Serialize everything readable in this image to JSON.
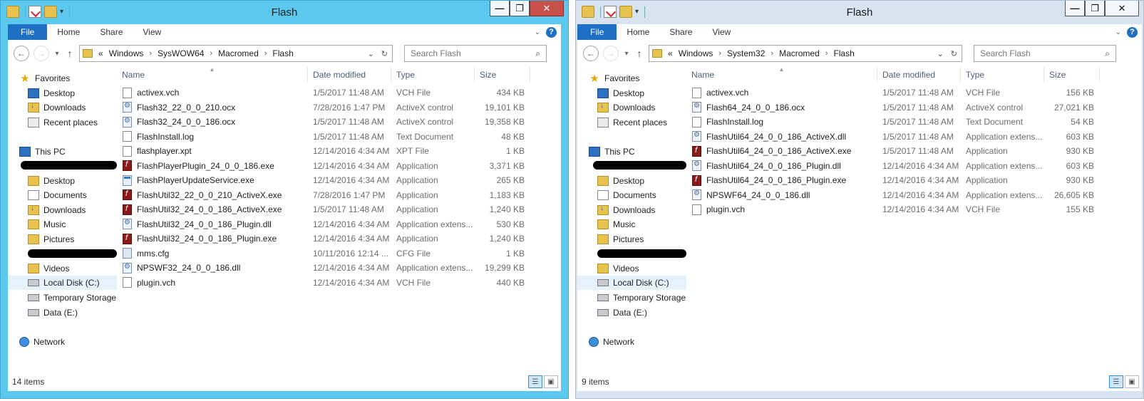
{
  "windows": [
    {
      "title": "Flash",
      "ribbon_tabs": [
        "File",
        "Home",
        "Share",
        "View"
      ],
      "address": [
        "«",
        "Windows",
        "SysWOW64",
        "Macromed",
        "Flash"
      ],
      "search_placeholder": "Search Flash",
      "nav": {
        "favorites": "Favorites",
        "desktop": "Desktop",
        "downloads": "Downloads",
        "recent": "Recent places",
        "thispc": "This PC",
        "pc_desktop": "Desktop",
        "documents": "Documents",
        "pc_downloads": "Downloads",
        "music": "Music",
        "pictures": "Pictures",
        "videos": "Videos",
        "localdisk": "Local Disk (C:)",
        "tempstorage": "Temporary Storage (",
        "data": "Data (E:)",
        "network": "Network"
      },
      "columns": [
        "Name",
        "Date modified",
        "Type",
        "Size"
      ],
      "files": [
        {
          "name": "activex.vch",
          "date": "1/5/2017 11:48 AM",
          "type": "VCH File",
          "size": "434 KB",
          "icon": "doc"
        },
        {
          "name": "Flash32_22_0_0_210.ocx",
          "date": "7/28/2016 1:47 PM",
          "type": "ActiveX control",
          "size": "19,101 KB",
          "icon": "gear"
        },
        {
          "name": "Flash32_24_0_0_186.ocx",
          "date": "1/5/2017 11:48 AM",
          "type": "ActiveX control",
          "size": "19,358 KB",
          "icon": "gear"
        },
        {
          "name": "FlashInstall.log",
          "date": "1/5/2017 11:48 AM",
          "type": "Text Document",
          "size": "48 KB",
          "icon": "doc"
        },
        {
          "name": "flashplayer.xpt",
          "date": "12/14/2016 4:34 AM",
          "type": "XPT File",
          "size": "1 KB",
          "icon": "doc"
        },
        {
          "name": "FlashPlayerPlugin_24_0_0_186.exe",
          "date": "12/14/2016 4:34 AM",
          "type": "Application",
          "size": "3,371 KB",
          "icon": "flash"
        },
        {
          "name": "FlashPlayerUpdateService.exe",
          "date": "12/14/2016 4:34 AM",
          "type": "Application",
          "size": "265 KB",
          "icon": "app"
        },
        {
          "name": "FlashUtil32_22_0_0_210_ActiveX.exe",
          "date": "7/28/2016 1:47 PM",
          "type": "Application",
          "size": "1,183 KB",
          "icon": "flash"
        },
        {
          "name": "FlashUtil32_24_0_0_186_ActiveX.exe",
          "date": "1/5/2017 11:48 AM",
          "type": "Application",
          "size": "1,240 KB",
          "icon": "flash"
        },
        {
          "name": "FlashUtil32_24_0_0_186_Plugin.dll",
          "date": "12/14/2016 4:34 AM",
          "type": "Application extens...",
          "size": "530 KB",
          "icon": "gear"
        },
        {
          "name": "FlashUtil32_24_0_0_186_Plugin.exe",
          "date": "12/14/2016 4:34 AM",
          "type": "Application",
          "size": "1,240 KB",
          "icon": "flash"
        },
        {
          "name": "mms.cfg",
          "date": "10/11/2016 12:14 ...",
          "type": "CFG File",
          "size": "1 KB",
          "icon": "cfg"
        },
        {
          "name": "NPSWF32_24_0_0_186.dll",
          "date": "12/14/2016 4:34 AM",
          "type": "Application extens...",
          "size": "19,299 KB",
          "icon": "gear"
        },
        {
          "name": "plugin.vch",
          "date": "12/14/2016 4:34 AM",
          "type": "VCH File",
          "size": "440 KB",
          "icon": "doc"
        }
      ],
      "status": "14 items"
    },
    {
      "title": "Flash",
      "ribbon_tabs": [
        "File",
        "Home",
        "Share",
        "View"
      ],
      "address": [
        "«",
        "Windows",
        "System32",
        "Macromed",
        "Flash"
      ],
      "search_placeholder": "Search Flash",
      "nav": {
        "favorites": "Favorites",
        "desktop": "Desktop",
        "downloads": "Downloads",
        "recent": "Recent places",
        "thispc": "This PC",
        "pc_desktop": "Desktop",
        "documents": "Documents",
        "pc_downloads": "Downloads",
        "music": "Music",
        "pictures": "Pictures",
        "videos": "Videos",
        "localdisk": "Local Disk (C:)",
        "tempstorage": "Temporary Storage (",
        "data": "Data (E:)",
        "network": "Network"
      },
      "columns": [
        "Name",
        "Date modified",
        "Type",
        "Size"
      ],
      "files": [
        {
          "name": "activex.vch",
          "date": "1/5/2017 11:48 AM",
          "type": "VCH File",
          "size": "156 KB",
          "icon": "doc"
        },
        {
          "name": "Flash64_24_0_0_186.ocx",
          "date": "1/5/2017 11:48 AM",
          "type": "ActiveX control",
          "size": "27,021 KB",
          "icon": "gear"
        },
        {
          "name": "FlashInstall.log",
          "date": "1/5/2017 11:48 AM",
          "type": "Text Document",
          "size": "54 KB",
          "icon": "doc"
        },
        {
          "name": "FlashUtil64_24_0_0_186_ActiveX.dll",
          "date": "1/5/2017 11:48 AM",
          "type": "Application extens...",
          "size": "603 KB",
          "icon": "gear"
        },
        {
          "name": "FlashUtil64_24_0_0_186_ActiveX.exe",
          "date": "1/5/2017 11:48 AM",
          "type": "Application",
          "size": "930 KB",
          "icon": "flash"
        },
        {
          "name": "FlashUtil64_24_0_0_186_Plugin.dll",
          "date": "12/14/2016 4:34 AM",
          "type": "Application extens...",
          "size": "603 KB",
          "icon": "gear"
        },
        {
          "name": "FlashUtil64_24_0_0_186_Plugin.exe",
          "date": "12/14/2016 4:34 AM",
          "type": "Application",
          "size": "930 KB",
          "icon": "flash"
        },
        {
          "name": "NPSWF64_24_0_0_186.dll",
          "date": "12/14/2016 4:34 AM",
          "type": "Application extens...",
          "size": "26,605 KB",
          "icon": "gear"
        },
        {
          "name": "plugin.vch",
          "date": "12/14/2016 4:34 AM",
          "type": "VCH File",
          "size": "155 KB",
          "icon": "doc"
        }
      ],
      "status": "9 items"
    }
  ]
}
